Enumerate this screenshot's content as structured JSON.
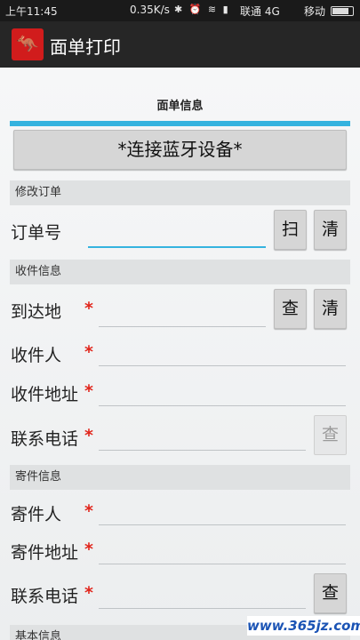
{
  "status_bar": {
    "time": "上午11:45",
    "speed": "0.35K/s",
    "icons": "✱ ⏰ ≋ ▮",
    "carrier1": "联通 4G",
    "carrier2": "移动"
  },
  "app": {
    "title": "面单打印",
    "logo_icon": "kangaroo-logo"
  },
  "tab": {
    "label": "面单信息"
  },
  "connect_button": "*连接蓝牙设备*",
  "modify_order": {
    "header": "修改订单",
    "order_no_label": "订单号",
    "order_no_value": "",
    "scan_button": "扫",
    "clear_button": "清"
  },
  "receiver": {
    "header": "收件信息",
    "destination_label": "到达地",
    "destination_required": "*",
    "query_button": "查",
    "clear_button": "清",
    "name_label": "收件人",
    "name_required": "*",
    "address_label": "收件地址",
    "address_required": "*",
    "phone_label": "联系电话",
    "phone_required": "*",
    "phone_query_button": "查"
  },
  "sender": {
    "header": "寄件信息",
    "name_label": "寄件人",
    "name_required": "*",
    "address_label": "寄件地址",
    "address_required": "*",
    "phone_label": "联系电话",
    "phone_required": "*",
    "phone_query_button": "查"
  },
  "basic": {
    "header": "基本信息"
  },
  "watermark": "www.365jz.com",
  "colors": {
    "accent": "#35b3df",
    "required": "#e1251b",
    "logo": "#d11c1c"
  }
}
